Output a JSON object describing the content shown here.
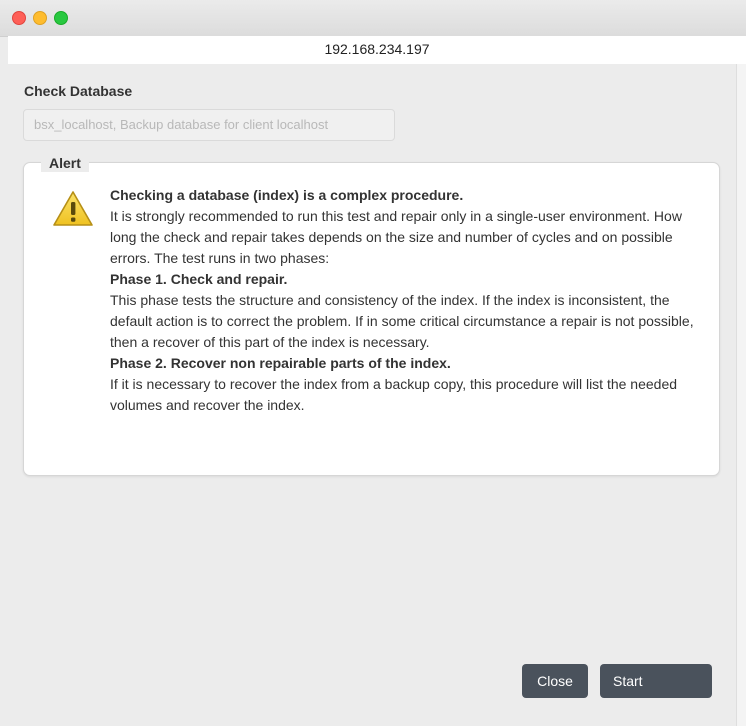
{
  "window": {
    "address": "192.168.234.197"
  },
  "dialog": {
    "section_title": "Check Database",
    "database_field_value": "bsx_localhost, Backup database for client localhost",
    "alert": {
      "legend": "Alert",
      "icon": "warning-icon",
      "heading": "Checking a database (index) is a complex procedure.",
      "intro": "It is strongly recommended to run this test and repair only in a single-user environment. How long the check and repair takes depends on the size and number of cycles and on possible errors. The test runs in two phases:",
      "phase1_title": "Phase 1. Check and repair.",
      "phase1_text": "This phase tests the structure and consistency of the index. If the index is inconsistent, the default action is to correct the problem. If in some critical circumstance a repair is not possible, then a recover of this part of the index is necessary.",
      "phase2_title": "Phase 2. Recover non repairable parts of the index.",
      "phase2_text": "If it is necessary to recover the index from a backup copy, this procedure will list the needed volumes and recover the index."
    },
    "buttons": {
      "close": "Close",
      "start": "Start"
    }
  },
  "colors": {
    "button_bg": "#4a525c",
    "warning_yellow": "#f5d33a"
  }
}
